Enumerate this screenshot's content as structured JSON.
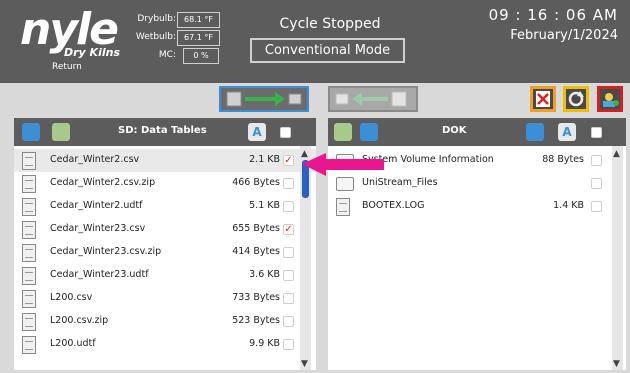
{
  "header": {
    "brand": "nyle",
    "brand_sub": "Dry Kilns",
    "return_label": "Return",
    "drybulb_label": "Drybulb:",
    "drybulb_value": "68.1 °F",
    "wetbulb_label": "Wetbulb:",
    "wetbulb_value": "67.1 °F",
    "mc_label": "MC:",
    "mc_value": "0 %",
    "cycle_status": "Cycle Stopped",
    "mode": "Conventional Mode",
    "time": "09 : 16 : 06  AM",
    "date": "February/1/2024"
  },
  "left_panel": {
    "title": "SD: Data Tables",
    "files": [
      {
        "name": "Cedar_Winter2.csv",
        "size": "2.1 KB",
        "checked": true
      },
      {
        "name": "Cedar_Winter2.csv.zip",
        "size": "466 Bytes",
        "checked": false
      },
      {
        "name": "Cedar_Winter2.udtf",
        "size": "5.1 KB",
        "checked": false
      },
      {
        "name": "Cedar_Winter23.csv",
        "size": "655 Bytes",
        "checked": true
      },
      {
        "name": "Cedar_Winter23.csv.zip",
        "size": "414 Bytes",
        "checked": false
      },
      {
        "name": "Cedar_Winter23.udtf",
        "size": "3.6 KB",
        "checked": false
      },
      {
        "name": "L200.csv",
        "size": "733 Bytes",
        "checked": false
      },
      {
        "name": "L200.csv.zip",
        "size": "523 Bytes",
        "checked": false
      },
      {
        "name": "L200.udtf",
        "size": "9.9 KB",
        "checked": false
      }
    ]
  },
  "right_panel": {
    "title": "DOK",
    "files": [
      {
        "name": "System Volume Information",
        "size": "88 Bytes",
        "type": "folder"
      },
      {
        "name": "UniStream_Files",
        "size": "",
        "type": "folder"
      },
      {
        "name": "BOOTEX.LOG",
        "size": "1.4 KB",
        "type": "file"
      }
    ]
  },
  "colors": {
    "header_bg": "#5c5c5c",
    "pointer_arrow": "#e8168f",
    "checkmark": "#dd2222",
    "selected_row": "#e9e9e9",
    "scroll_thumb": "#2a5fc4"
  }
}
